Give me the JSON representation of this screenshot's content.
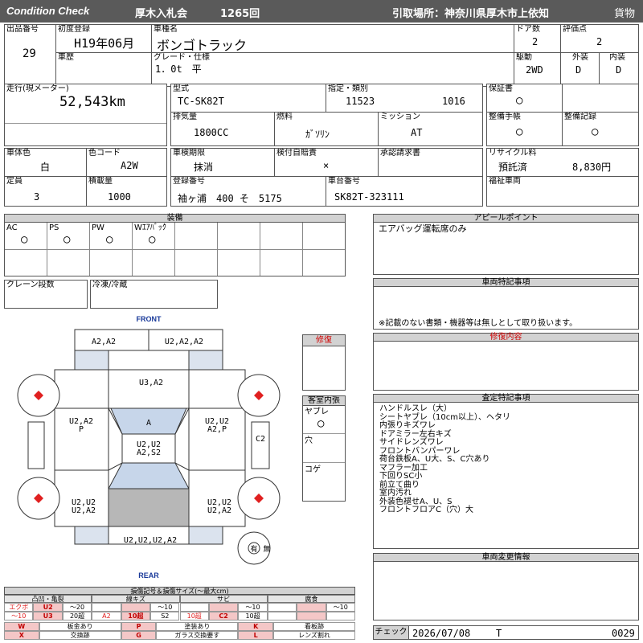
{
  "header": {
    "brand": "Condition Check",
    "auction": "厚木入札会",
    "auction_no": "1265回",
    "pickup": "引取場所：神奈川県厚木市上依知",
    "category": "貨物"
  },
  "row1": {
    "lot_label": "出品番号",
    "lot": "29",
    "reg_label": "初度登録",
    "reg": "H19年06月",
    "name_label": "車種名",
    "name": "ボンゴトラック",
    "doors_label": "ドア数",
    "doors": "2",
    "score_label": "評価点",
    "score": "2"
  },
  "row2": {
    "history_label": "車歴",
    "grade_label": "グレード・仕様",
    "grade": "1．0t　平",
    "drive_label": "駆動",
    "drive": "2WD",
    "ext_label": "外装",
    "ext": "D",
    "int_label": "内装",
    "int": "D"
  },
  "mileage": {
    "label": "走行(現メーター)",
    "value": "52,543km"
  },
  "model": {
    "label": "型式",
    "value": "TC-SK82T",
    "class_label": "指定・類別",
    "class_a": "11523",
    "class_b": "1016",
    "warranty_label": "保証書",
    "warranty": "○"
  },
  "engine": {
    "disp_label": "排気量",
    "disp": "1800CC",
    "fuel_label": "燃料",
    "fuel": "ｶﾞｿﾘﾝ",
    "mission_label": "ミッション",
    "mission": "AT",
    "manual_label": "整備手帳",
    "manual": "○",
    "record_label": "整備記録",
    "record": "○"
  },
  "body": {
    "color_label": "車体色",
    "color": "白",
    "code_label": "色コード",
    "code": "A2W",
    "inspect_label": "車検期限",
    "inspect": "抹消",
    "selfcheck_label": "検付自賠責",
    "selfcheck": "×",
    "approval_label": "承認請求書",
    "recycle_label": "リサイクル料",
    "recycle_status": "預託済",
    "recycle_amount": "8,830円"
  },
  "capacity": {
    "seats_label": "定員",
    "seats": "3",
    "load_label": "積載量",
    "load": "1000",
    "plate_label": "登録番号",
    "plate": "袖ヶ浦　400 そ　5175",
    "frame_label": "車台番号",
    "frame": "SK82T-323111",
    "welfare_label": "福祉車両"
  },
  "equip": {
    "title": "装備",
    "items": [
      {
        "label": "AC",
        "value": "○"
      },
      {
        "label": "PS",
        "value": "○"
      },
      {
        "label": "PW",
        "value": "○"
      },
      {
        "label": "Wｴｱﾊﾞｯｸ",
        "value": "○"
      }
    ],
    "crane_label": "クレーン段数",
    "freezer_label": "冷凍/冷蔵"
  },
  "appeal": {
    "title": "アピールポイント",
    "text": "エアバッグ運転席のみ"
  },
  "special": {
    "title": "車両特記事項",
    "note": "※記載のない書類・機器等は無しとして取り扱います。"
  },
  "repair": {
    "title": "修復内容",
    "short": "修復"
  },
  "inspection": {
    "title": "査定特記事項",
    "lines": [
      "ハンドルスレ（大）",
      "シートヤブレ（10cm以上）、ヘタリ",
      "内張りキズワレ",
      "ドアミラー左右キズ",
      "サイドレンズワレ",
      "フロントバンパーワレ",
      "荷台鉄板A、U大、S、C穴あり",
      "マフラー加工",
      "下回りSC小",
      "前立て曲り",
      "室内汚れ",
      "外装色褪せA、U、S",
      "フロントフロアC（穴）大"
    ]
  },
  "changes": {
    "title": "車両変更情報"
  },
  "cabin": {
    "title": "客室内張",
    "items": [
      "ヤブレ",
      "穴",
      "コゲ"
    ],
    "tear": "○"
  },
  "diagram": {
    "front": "FRONT",
    "rear": "REAR",
    "labels": {
      "front_left": "A2,A2",
      "front_right": "U2,A2,A2",
      "hood": "U3,A2",
      "windshield": "A",
      "left_door": "U2,A2\nP",
      "right_door": "U2,U2\nA2,P",
      "cab_roof": "U2,U2\nA2,S2",
      "right_side": "C2",
      "left_bed": "U2,U2\nU2,A2",
      "right_bed": "U2,U2\nU2,A2",
      "rear": "U2,U2,U2,A2"
    },
    "spare": "有",
    "spare_none": "無"
  },
  "legend": {
    "title": "損傷記号＆損傷サイズ(～最大cm)",
    "groups": [
      "凸凹・亀裂",
      "線キズ",
      "サビ",
      "腐食"
    ],
    "r1": [
      "エクボ",
      "U2",
      "～20",
      "",
      "",
      "～10",
      "",
      "",
      "～10",
      "",
      "",
      "～10"
    ],
    "r2": [
      "～10",
      "U3",
      "20超",
      "A2",
      "10超",
      "S2",
      "10超",
      "C2",
      "10超",
      "",
      "",
      ""
    ],
    "codes": [
      {
        "k": "W",
        "v": "板金あり"
      },
      {
        "k": "P",
        "v": "塗装あり"
      },
      {
        "k": "K",
        "v": "看板跡"
      },
      {
        "k": "X",
        "v": "交換跡"
      },
      {
        "k": "G",
        "v": "ガラス交換要す"
      },
      {
        "k": "L",
        "v": "レンズ割れ"
      }
    ]
  },
  "check": {
    "label": "チェック",
    "date": "2026/07/08",
    "initial": "T",
    "no": "0029"
  }
}
